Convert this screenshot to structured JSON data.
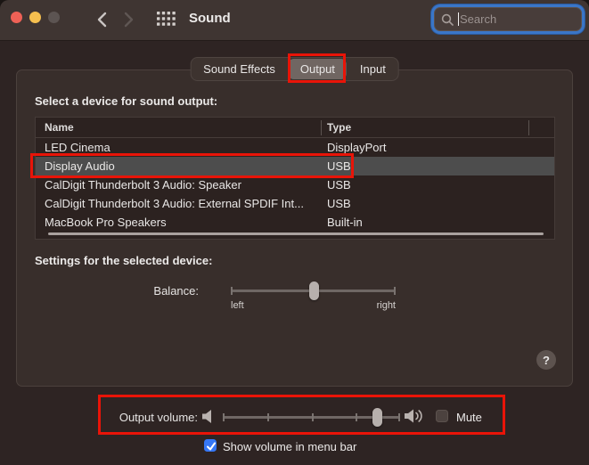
{
  "window": {
    "title": "Sound"
  },
  "toolbar": {
    "search_placeholder": "Search"
  },
  "tabs": [
    {
      "label": "Sound Effects",
      "selected": false
    },
    {
      "label": "Output",
      "selected": true
    },
    {
      "label": "Input",
      "selected": false
    }
  ],
  "output_section": {
    "select_label": "Select a device for sound output:",
    "table": {
      "columns": [
        "Name",
        "Type"
      ],
      "rows": [
        {
          "name": "LED Cinema",
          "type": "DisplayPort",
          "selected": false
        },
        {
          "name": "Display Audio",
          "type": "USB",
          "selected": true
        },
        {
          "name": "CalDigit Thunderbolt 3 Audio: Speaker",
          "type": "USB",
          "selected": false
        },
        {
          "name": "CalDigit Thunderbolt 3 Audio: External SPDIF Int...",
          "type": "USB",
          "selected": false
        },
        {
          "name": "MacBook Pro Speakers",
          "type": "Built-in",
          "selected": false
        }
      ]
    },
    "settings_label": "Settings for the selected device:",
    "balance": {
      "label": "Balance:",
      "left_label": "left",
      "right_label": "right",
      "value_percent": 50
    },
    "help_label": "?"
  },
  "footer": {
    "output_volume_label": "Output volume:",
    "volume_percent": 87,
    "mute_label": "Mute",
    "mute_checked": false,
    "show_volume_label": "Show volume in menu bar",
    "show_volume_checked": true
  },
  "colors": {
    "annotation_red": "#e91408",
    "accent_blue": "#3577f6",
    "focus_ring_blue": "#2f6fce",
    "selected_row_gray": "#4d4d4d"
  }
}
